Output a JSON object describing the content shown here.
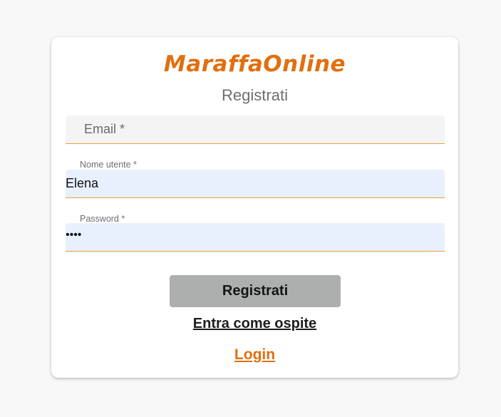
{
  "brand": {
    "logo_text": "MaraffaOnline",
    "accent_color": "#e07010"
  },
  "form": {
    "title": "Registrati",
    "email": {
      "placeholder": "Email *",
      "value": ""
    },
    "username": {
      "label": "Nome utente *",
      "value": "Elena"
    },
    "password": {
      "label": "Password *",
      "masked_value": "••••"
    },
    "submit_label": "Registrati",
    "guest_link": "Entra come ospite",
    "login_link": "Login"
  }
}
